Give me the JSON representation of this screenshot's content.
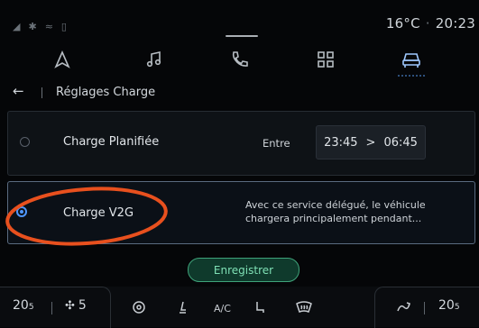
{
  "status": {
    "temperature": "16°C",
    "separator": "·",
    "time": "20:23"
  },
  "nav": {
    "items": [
      "navigation-icon",
      "music-icon",
      "phone-icon",
      "apps-icon",
      "car-icon"
    ],
    "active_item": "car-icon",
    "accent_color": "#9fc8ff"
  },
  "breadcrumb": {
    "back": "←",
    "title": "Réglages Charge"
  },
  "options": [
    {
      "label": "Charge Planifiée",
      "selected": false,
      "between_label": "Entre",
      "time_start": "23:45",
      "arrow": ">",
      "time_end": "06:45"
    },
    {
      "label": "Charge V2G",
      "selected": true,
      "description_line1": "Avec ce service délégué, le véhicule",
      "description_line2": "chargera principalement pendant..."
    }
  ],
  "save_button": {
    "label": "Enregistrer",
    "color": "#3fa37a"
  },
  "climate": {
    "left_temp": "20",
    "left_temp_suffix": "5",
    "fan_speed": "5",
    "ac_label": "A/C",
    "right_temp": "20",
    "right_temp_suffix": "5",
    "icons": [
      "fan-icon",
      "steering-heat-icon",
      "seat-heat-icon",
      "air-recirculation-icon",
      "seat-heat-passenger-icon",
      "windshield-defrost-icon",
      "seat-ventilation-icon"
    ]
  },
  "annotation": {
    "color": "#e8501e"
  }
}
